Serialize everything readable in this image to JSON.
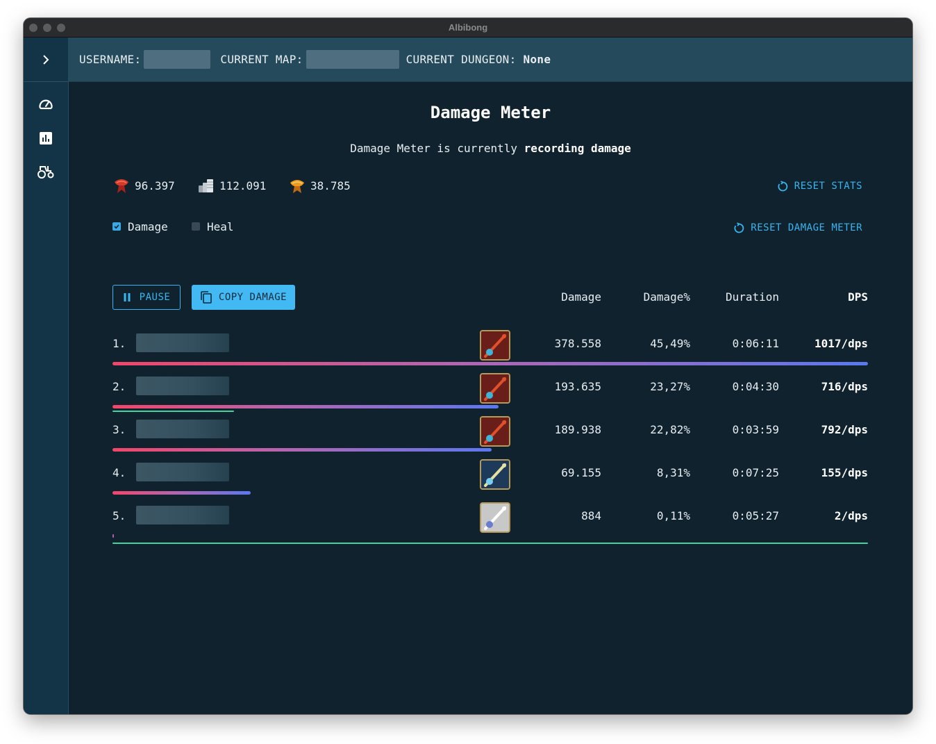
{
  "window": {
    "title": "Albibong"
  },
  "topbar": {
    "username_label": "USERNAME:",
    "map_label": "CURRENT MAP:",
    "dungeon_label": "CURRENT DUNGEON:",
    "dungeon_value": "None"
  },
  "sidebar": {
    "toggle_icon": "chevron-right-icon",
    "items": [
      {
        "icon": "speedometer-icon"
      },
      {
        "icon": "bar-chart-icon"
      },
      {
        "icon": "tractor-icon"
      }
    ]
  },
  "meter": {
    "title": "Damage Meter",
    "status_prefix": "Damage Meter is currently",
    "status_value": "recording damage"
  },
  "currencies": [
    {
      "icon": "fame-icon",
      "value": "96.397"
    },
    {
      "icon": "silver-icon",
      "value": "112.091"
    },
    {
      "icon": "respec-icon",
      "value": "38.785"
    }
  ],
  "actions": {
    "reset_stats": "RESET STATS",
    "reset_damage_meter": "RESET DAMAGE METER",
    "pause": "PAUSE",
    "copy_damage": "COPY DAMAGE"
  },
  "filters": {
    "damage": {
      "label": "Damage",
      "checked": true
    },
    "heal": {
      "label": "Heal",
      "checked": false
    }
  },
  "table": {
    "headers": {
      "damage": "Damage",
      "damage_pct": "Damage%",
      "duration": "Duration",
      "dps": "DPS"
    },
    "rows": [
      {
        "rank": "1.",
        "weapon": "fire-staff-icon",
        "damage": "378.558",
        "damage_pct": "45,49%",
        "duration": "0:06:11",
        "dps": "1017/dps",
        "damage_fraction": 1.0,
        "heal_fraction": 0
      },
      {
        "rank": "2.",
        "weapon": "fire-staff-icon",
        "damage": "193.635",
        "damage_pct": "23,27%",
        "duration": "0:04:30",
        "dps": "716/dps",
        "damage_fraction": 0.511,
        "heal_fraction": 0.161
      },
      {
        "rank": "3.",
        "weapon": "fire-staff-icon",
        "damage": "189.938",
        "damage_pct": "22,82%",
        "duration": "0:03:59",
        "dps": "792/dps",
        "damage_fraction": 0.502,
        "heal_fraction": 0
      },
      {
        "rank": "4.",
        "weapon": "frost-staff-icon",
        "damage": "69.155",
        "damage_pct": "8,31%",
        "duration": "0:07:25",
        "dps": "155/dps",
        "damage_fraction": 0.183,
        "heal_fraction": 0
      },
      {
        "rank": "5.",
        "weapon": "holy-staff-icon",
        "damage": "884",
        "damage_pct": "0,11%",
        "duration": "0:05:27",
        "dps": "2/dps",
        "damage_fraction": 0.002,
        "heal_fraction": 1.0
      }
    ]
  }
}
